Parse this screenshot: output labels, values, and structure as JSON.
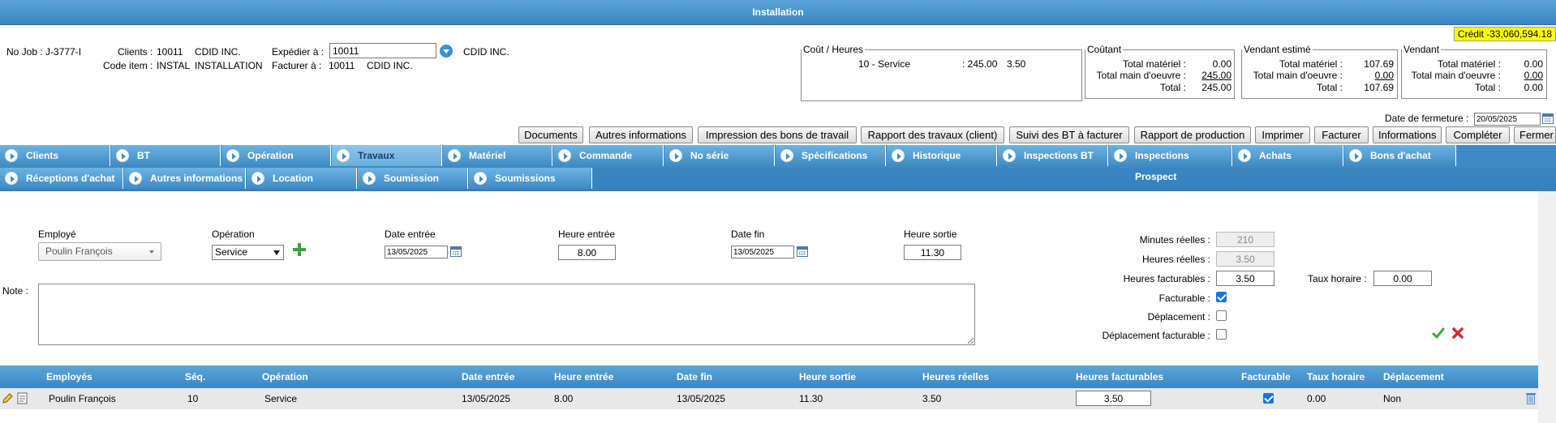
{
  "window": {
    "title": "Installation"
  },
  "credit": "Crédit -33,060,594.18",
  "job": {
    "no_job": "No Job : J-3777-I",
    "clients_label": "Clients :",
    "clients_code": "10011",
    "clients_name": "CDID INC.",
    "code_item_label": "Code item :",
    "code_item_code": "INSTAL",
    "code_item_name": "INSTALLATION",
    "expedier_label": "Expédier à :",
    "expedier_value": "10011",
    "expedier_name": "CDID INC.",
    "facturer_label": "Facturer à :",
    "facturer_code": "10011",
    "facturer_name": "CDID INC."
  },
  "cout_heures": {
    "legend": "Coût / Heures",
    "line": "10 - Service",
    "amount": ": 245.00",
    "hours": "3.50"
  },
  "coutant": {
    "legend": "Coûtant",
    "rows": [
      {
        "label": "Total matériel :",
        "value": "0.00"
      },
      {
        "label": "Total main d'oeuvre :",
        "value": "245.00"
      },
      {
        "label": "Total :",
        "value": "245.00"
      }
    ]
  },
  "vendant_estime": {
    "legend": "Vendant estimé",
    "rows": [
      {
        "label": "Total matériel :",
        "value": "107.69"
      },
      {
        "label": "Total main d'oeuvre :",
        "value": "0.00"
      },
      {
        "label": "Total :",
        "value": "107.69"
      }
    ]
  },
  "vendant": {
    "legend": "Vendant",
    "rows": [
      {
        "label": "Total matériel :",
        "value": "0.00"
      },
      {
        "label": "Total main d'oeuvre :",
        "value": "0.00"
      },
      {
        "label": "Total :",
        "value": "0.00"
      }
    ]
  },
  "fermeture": {
    "label": "Date de fermeture :",
    "value": "20/05/2025"
  },
  "toolbar": [
    "Documents",
    "Autres informations",
    "Impression des bons de travail",
    "Rapport des travaux (client)",
    "Suivi des BT à facturer",
    "Rapport de production",
    "Imprimer",
    "Facturer",
    "Informations",
    "Compléter",
    "Fermer"
  ],
  "tabs_row1": [
    "Clients",
    "BT",
    "Opération",
    "Travaux",
    "Matériel",
    "Commande",
    "No série",
    "Spécifications",
    "Historique",
    "Inspections BT",
    "Inspections Prospect",
    "Achats",
    "Bons d'achat"
  ],
  "tabs_row2": [
    "Réceptions d'achat",
    "Autres informations",
    "Location",
    "Soumission",
    "Soumissions d'achat"
  ],
  "active_tab": "Travaux",
  "form": {
    "employe_label": "Employé",
    "employe_value": "Poulin François",
    "operation_label": "Opération",
    "operation_value": "Service",
    "date_entree_label": "Date entrée",
    "date_entree_value": "13/05/2025",
    "heure_entree_label": "Heure entrée",
    "heure_entree_value": "8.00",
    "date_fin_label": "Date fin",
    "date_fin_value": "13/05/2025",
    "heure_sortie_label": "Heure sortie",
    "heure_sortie_value": "11.30",
    "note_label": "Note :",
    "minutes_reelles_label": "Minutes réelles :",
    "minutes_reelles_value": "210",
    "heures_reelles_label": "Heures réelles :",
    "heures_reelles_value": "3.50",
    "heures_facturables_label": "Heures facturables :",
    "heures_facturables_value": "3.50",
    "taux_horaire_label": "Taux horaire :",
    "taux_horaire_value": "0.00",
    "facturable_label": "Facturable :",
    "facturable_checked": true,
    "deplacement_label": "Déplacement :",
    "deplacement_checked": false,
    "deplacement_facturable_label": "Déplacement facturable :",
    "deplacement_facturable_checked": false
  },
  "grid": {
    "headers": [
      "Employés",
      "Séq.",
      "Opération",
      "Date entrée",
      "Heure entrée",
      "Date fin",
      "Heure sortie",
      "Heures réelles",
      "Heures facturables",
      "Facturable",
      "Taux horaire",
      "Déplacement"
    ],
    "row": {
      "employe": "Poulin François",
      "seq": "10",
      "operation": "Service",
      "date_entree": "13/05/2025",
      "heure_entree": "8.00",
      "date_fin": "13/05/2025",
      "heure_sortie": "11.30",
      "heures_reelles": "3.50",
      "heures_facturables": "3.50",
      "facturable": true,
      "taux_horaire": "0.00",
      "deplacement": "Non"
    }
  },
  "colors": {
    "header_blue": "#3a86c2",
    "credit_yellow": "#ffff00",
    "save_green": "#3aa63a",
    "cancel_red": "#d42b2b"
  }
}
